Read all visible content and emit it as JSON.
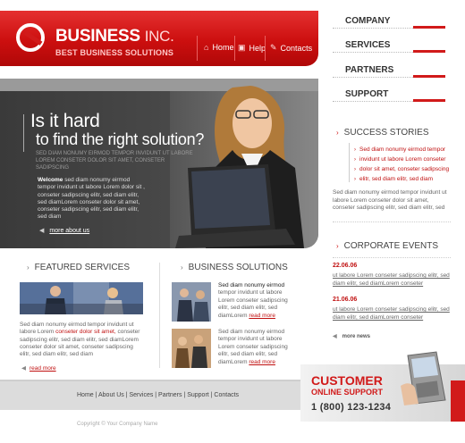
{
  "colors": {
    "brand_red": "#d11a1a",
    "hero_dark": "#3a3a3a",
    "footer_gray": "#dcdcdc"
  },
  "header": {
    "brand_main": "BUSINESS",
    "brand_suffix": "INC.",
    "tagline": "BEST BUSINESS SOLUTIONS",
    "nav": [
      {
        "label": "Home",
        "icon": "home-icon"
      },
      {
        "label": "Help",
        "icon": "help-icon"
      },
      {
        "label": "Contacts",
        "icon": "pencil-icon"
      }
    ]
  },
  "right_menu": [
    "COMPANY",
    "SERVICES",
    "PARTNERS",
    "SUPPORT"
  ],
  "hero": {
    "line1": "Is it hard",
    "line2": "to find the right solution?",
    "sub": "SED DIAM NONUMY EIRMOD TEMPOR INVIDUNT UT LABORE LOREM CONSETER DOLOR SIT AMET, CONSETER SADIPSCING",
    "welcome_bold": "Welcome",
    "welcome_text": " sed diam nonumy eirmod tempor invidunt ut labore Lorem dolor sit , conseter sadipscing elitr, sed diam elitr, sed diamLorem conseter dolor sit amet, conseter sadipscing elitr, sed diam elitr, sed diam",
    "more": "more about us"
  },
  "success_stories": {
    "title": "SUCCESS STORIES",
    "items": [
      "Sed diam nonumy eirmod tempor",
      "invidunt ut labore Lorem conseter",
      "dolor sit amet, conseter sadipscing",
      "elitr, sed diam  elitr, sed diam"
    ],
    "text": "Sed diam nonumy eirmod tempor invidunt ut labore Lorem conseter dolor sit amet, conseter sadipscing elitr, sed diam  elitr, sed"
  },
  "corporate_events": {
    "title": "CORPORATE EVENTS",
    "events": [
      {
        "date": "22.06.06",
        "text": "ut labore Lorem conseter sadipscing elitr, sed diam  elitr, sed diamLorem conseter"
      },
      {
        "date": "21.06.06",
        "text": "ut labore Lorem conseter sadipscing elitr, sed diam  elitr, sed diamLorem conseter"
      }
    ],
    "more": "more news"
  },
  "featured": {
    "title": "FEATURED SERVICES",
    "text_a": "Sed diam nonumy eirmod tempor invidunt ut labore Lorem ",
    "text_red": "conseter dolor sit amet,",
    "text_b": " conseter sadipscing elitr, sed diam  elitr, sed diamLorem conseter dolor sit amet, conseter sadipscing elitr, sed diam  elitr, sed diam",
    "more": "read more"
  },
  "business": {
    "title": "BUSINESS SOLUTIONS",
    "items": [
      {
        "bold": "Sed diam nonumy eirmod",
        "text": " tempor invidunt ut labore Lorem conseter sadipscing elitr, sed diam  elitr, sed diamLorem ",
        "link": "read more"
      },
      {
        "bold": "",
        "text": "Sed diam nonumy eirmod tempor invidunt ut labore Lorem conseter sadipscing elitr, sed diam  elitr, sed diamLorem ",
        "link": "read more",
        "bold_mid": "invidunt ut labore"
      }
    ]
  },
  "footer": {
    "links": "Home | About Us | Services | Partners | Support | Contacts",
    "copyright": "Copyright © Your Company Name"
  },
  "support": {
    "line1": "CUSTOMER",
    "line2": "ONLINE SUPPORT",
    "phone": "1 (800) 123-1234"
  }
}
